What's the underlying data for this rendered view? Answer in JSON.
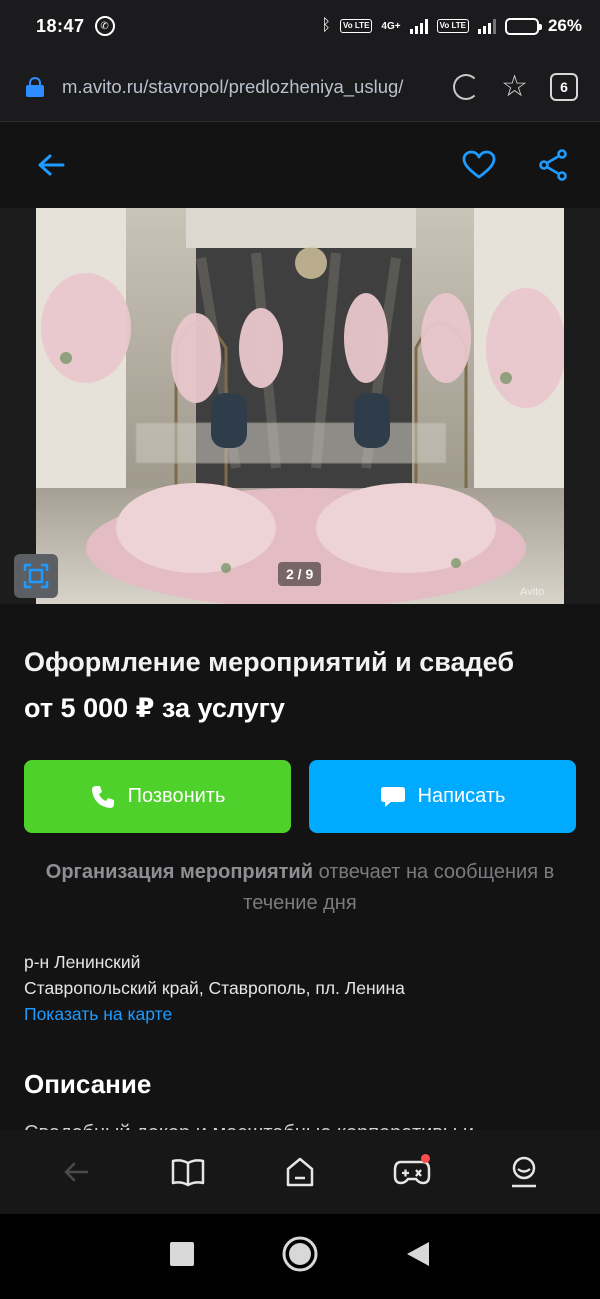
{
  "status": {
    "time": "18:47",
    "network": "4G+",
    "lte": "Vo LTE",
    "battery_pct": "26%",
    "battery_level": 0.26
  },
  "browser": {
    "url": "m.avito.ru/stavropol/predlozheniya_uslug/",
    "tab_count": "6"
  },
  "listing": {
    "image_counter": "2 / 9",
    "watermark": "Avito",
    "title": "Оформление мероприятий и свадеб",
    "price": "от 5 000 ₽ за услугу",
    "call_label": "Позвонить",
    "message_label": "Написать",
    "seller_name": "Организация мероприятий",
    "reply_text": "отвечает на сообщения в течение дня",
    "district": "р-н Ленинский",
    "address": "Ставропольский край, Ставрополь, пл. Ленина",
    "map_link": "Показать на карте",
    "description_heading": "Описание",
    "description_text": "Свадебный декор и масштабные корпоративы и"
  },
  "colors": {
    "call": "#4fd12b",
    "message": "#00aaff",
    "link": "#1d9bff",
    "accent": "#1d9bff"
  },
  "icons": {
    "back": "arrow-left-icon",
    "favorite": "heart-icon",
    "share": "share-icon",
    "expand": "fullscreen-icon",
    "call": "phone-icon",
    "message": "chat-bubble-icon"
  },
  "tab_bar": [
    "back",
    "catalog",
    "home",
    "games",
    "profile"
  ]
}
